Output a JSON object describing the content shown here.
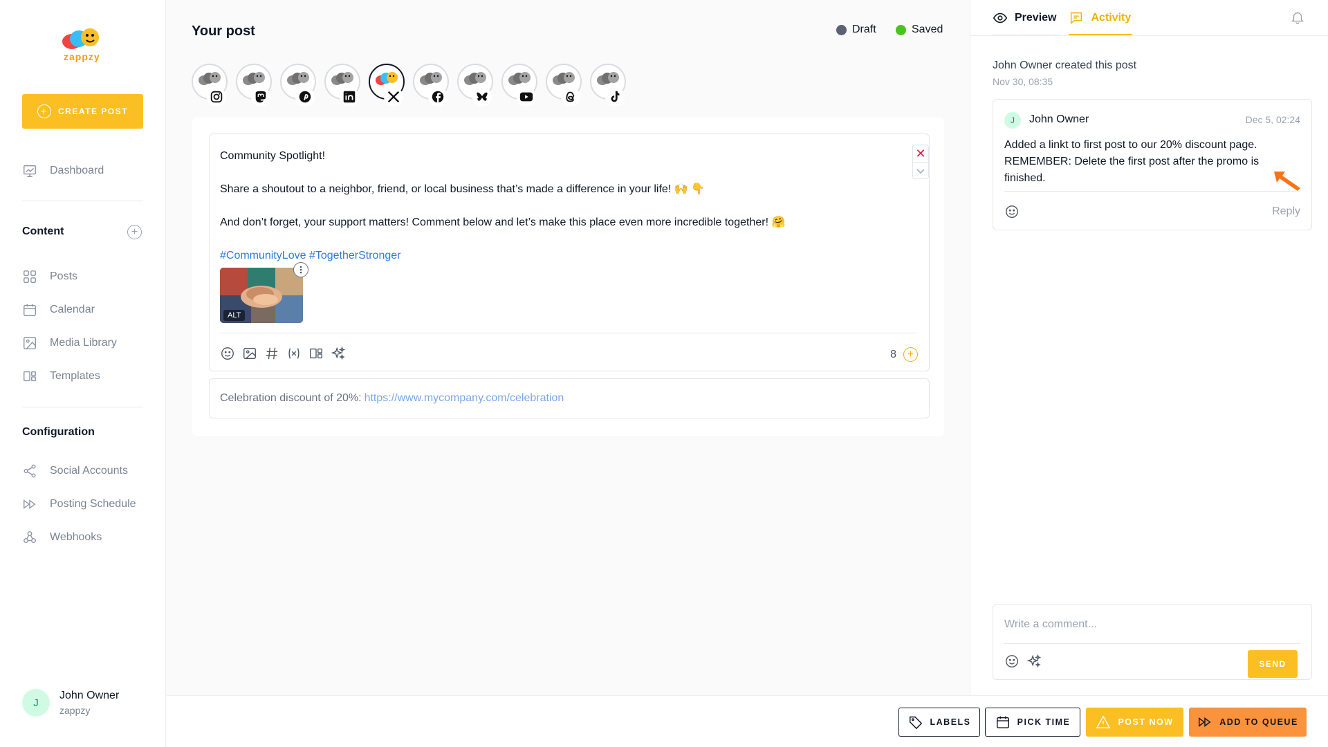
{
  "brand": {
    "name": "zappzy",
    "accent": "#fbbf24",
    "accent_dark": "#f5b100",
    "link": "#2f7bd9"
  },
  "sidebar": {
    "create_label": "CREATE POST",
    "dashboard": "Dashboard",
    "content_title": "Content",
    "content_items": [
      "Posts",
      "Calendar",
      "Media Library",
      "Templates"
    ],
    "config_title": "Configuration",
    "config_items": [
      "Social Accounts",
      "Posting Schedule",
      "Webhooks"
    ],
    "user": {
      "initial": "J",
      "name": "John Owner",
      "org": "zappzy"
    }
  },
  "main": {
    "title": "Your post",
    "status": {
      "draft": "Draft",
      "saved": "Saved",
      "draft_color": "#5b6372",
      "saved_color": "#4cc21d"
    },
    "accounts": [
      "instagram-icon",
      "mastodon-icon",
      "pinterest-icon",
      "linkedin-icon",
      "x-icon",
      "facebook-icon",
      "bluesky-icon",
      "youtube-icon",
      "threads-icon",
      "tiktok-icon"
    ],
    "selected_account": "x-icon",
    "post": {
      "line1": "Community Spotlight!",
      "line2": "Share a shoutout to a neighbor, friend, or local business that’s made a difference in your life! 🙌 👇",
      "line3": "And don’t forget, your support matters! Comment below and let’s make this place even more incredible together! 🤗",
      "hashtags": "#CommunityLove #TogetherStronger",
      "alt_label": "ALT"
    },
    "char_count": "8",
    "first_comment": {
      "text": "Celebration discount of 20%:",
      "link": "https://www.mycompany.com/celebration"
    }
  },
  "right": {
    "tabs": {
      "preview": "Preview",
      "activity": "Activity"
    },
    "created": "John Owner created this post",
    "created_date": "Nov 30, 08:35",
    "comment": {
      "initial": "J",
      "author": "John Owner",
      "date": "Dec 5, 02:24",
      "body": "Added a linkt to first post to our 20% discount page. REMEMBER: Delete the first post after the promo is finished.",
      "reply": "Reply"
    },
    "compose_placeholder": "Write a comment...",
    "send": "SEND"
  },
  "bottom": {
    "labels": "LABELS",
    "pick_time": "PICK TIME",
    "post_now": "POST NOW",
    "add_queue": "ADD TO QUEUE"
  }
}
